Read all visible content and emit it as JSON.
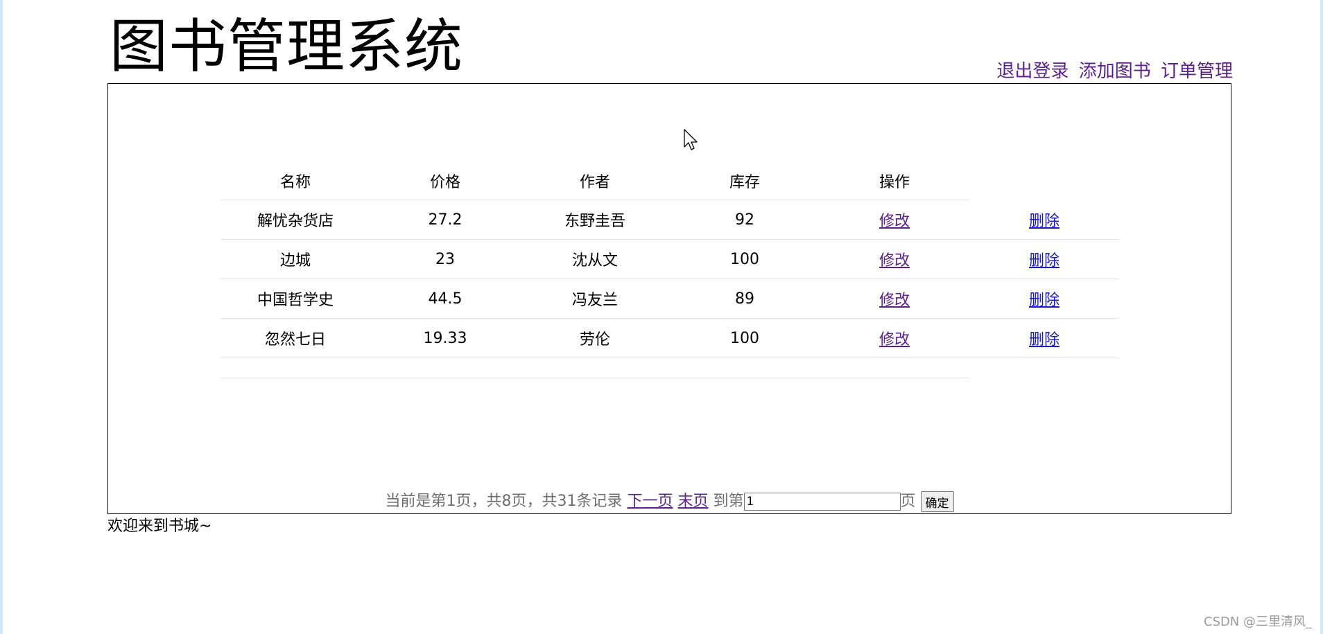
{
  "header": {
    "title": "图书管理系统",
    "nav": [
      "退出登录",
      "添加图书",
      "订单管理"
    ]
  },
  "table": {
    "columns": [
      "名称",
      "价格",
      "作者",
      "库存",
      "操作"
    ],
    "rows": [
      {
        "name": "解忧杂货店",
        "price": "27.2",
        "author": "东野圭吾",
        "stock": "92",
        "edit": "修改",
        "delete": "删除"
      },
      {
        "name": "边城",
        "price": "23",
        "author": "沈从文",
        "stock": "100",
        "edit": "修改",
        "delete": "删除"
      },
      {
        "name": "中国哲学史",
        "price": "44.5",
        "author": "冯友兰",
        "stock": "89",
        "edit": "修改",
        "delete": "删除"
      },
      {
        "name": "忽然七日",
        "price": "19.33",
        "author": "劳伦",
        "stock": "100",
        "edit": "修改",
        "delete": "删除"
      }
    ]
  },
  "pager": {
    "status": "当前是第1页，共8页，共31条记录",
    "next": "下一页",
    "last": "末页",
    "goto_prefix": "到第",
    "page_value": "1",
    "goto_suffix": "页",
    "confirm": "确定"
  },
  "footer": {
    "text": "欢迎来到书城~"
  },
  "watermark": "CSDN @三里清风_",
  "colors": {
    "visited_link": "#5b1f8f",
    "link": "#1a1acc",
    "border": "#000000",
    "row_line": "#e2e2e2"
  }
}
